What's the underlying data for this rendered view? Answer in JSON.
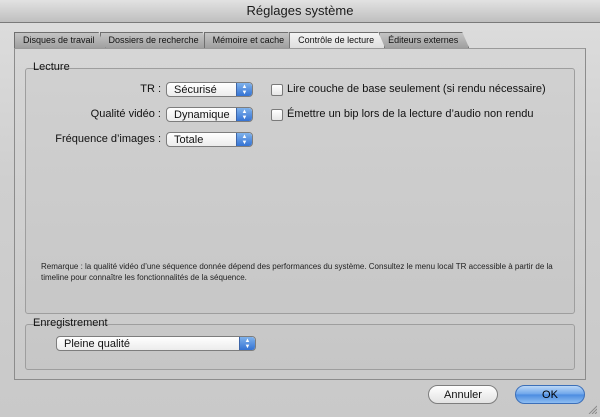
{
  "window": {
    "title": "Réglages système"
  },
  "tabs": [
    {
      "label": "Disques de travail",
      "active": false
    },
    {
      "label": "Dossiers de recherche",
      "active": false
    },
    {
      "label": "Mémoire et cache",
      "active": false
    },
    {
      "label": "Contrôle de lecture",
      "active": true
    },
    {
      "label": "Éditeurs externes",
      "active": false
    }
  ],
  "playback": {
    "group_title": "Lecture",
    "rt_label": "TR :",
    "rt_value": "Sécurisé",
    "video_quality_label": "Qualité vidéo :",
    "video_quality_value": "Dynamique",
    "frame_rate_label": "Fréquence d’images :",
    "frame_rate_value": "Totale",
    "base_layer_label": "Lire couche de base seulement (si rendu nécessaire)",
    "base_layer_checked": false,
    "beep_label": "Émettre un bip lors de la lecture d’audio non rendu",
    "beep_checked": false,
    "note": "Remarque : la qualité vidéo d’une séquence donnée dépend des performances du système. Consultez le menu local TR accessible à partir de la timeline pour connaître les fonctionnalités de la séquence."
  },
  "recording": {
    "group_title": "Enregistrement",
    "quality_value": "Pleine qualité"
  },
  "buttons": {
    "cancel": "Annuler",
    "ok": "OK"
  },
  "colors": {
    "accent": "#4a8be0",
    "popup_arrow": "#2f6ed1"
  }
}
